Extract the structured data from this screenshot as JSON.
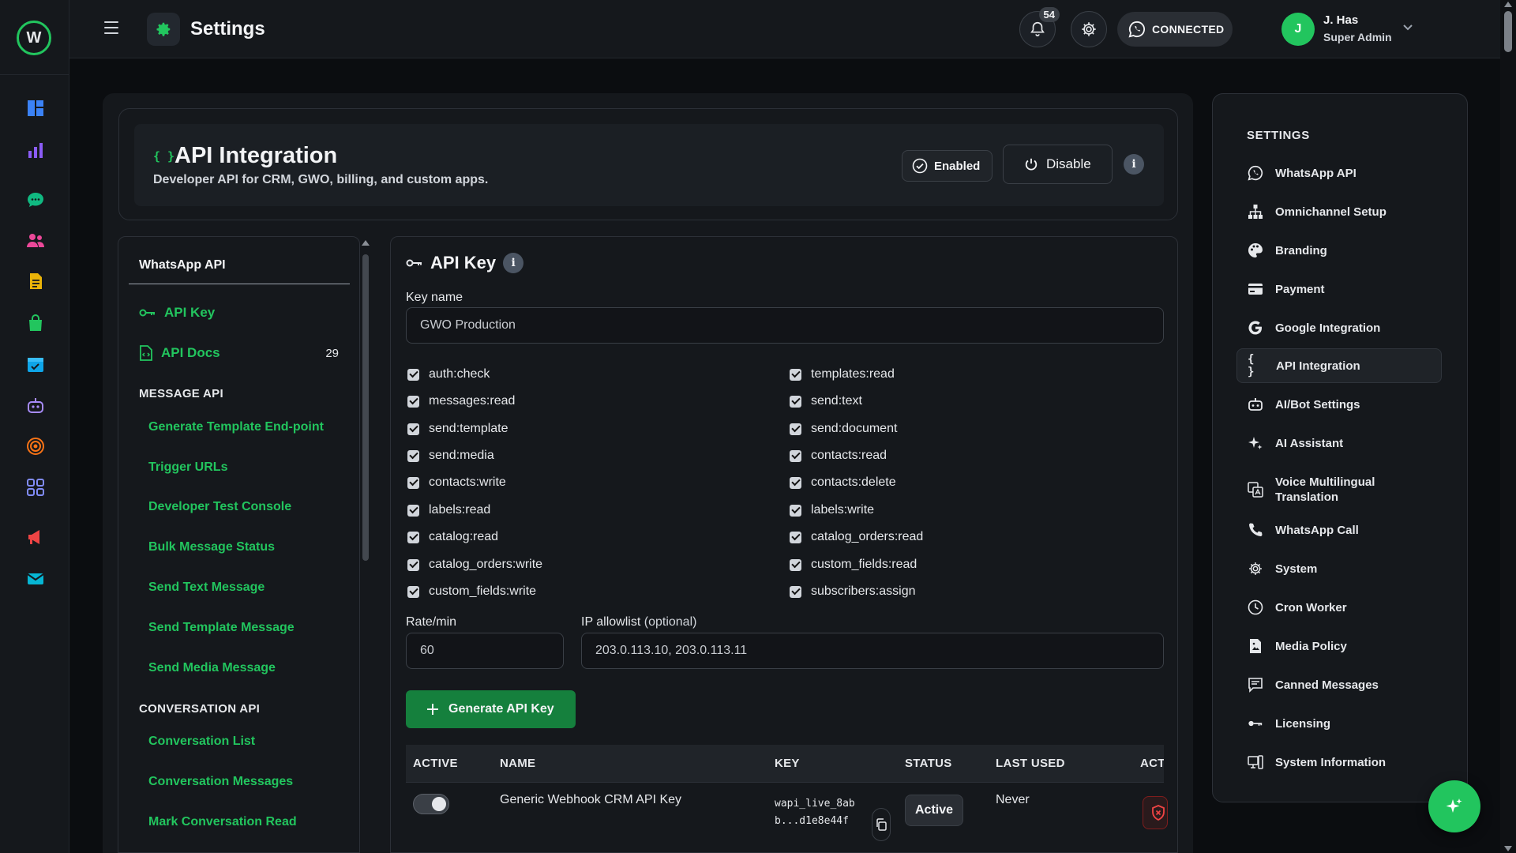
{
  "colors": {
    "accent": "#22c55e",
    "bg": "#0b0d10",
    "panel": "#15181c",
    "danger": "#ef4444"
  },
  "topbar": {
    "title": "Settings",
    "connection_status": "CONNECTED",
    "notifications_count": "54",
    "user": {
      "initial": "J",
      "name": "J. Has",
      "role": "Super Admin"
    }
  },
  "rail": {
    "icons": [
      "dashboard-icon",
      "analytics-icon",
      "chat-icon",
      "contacts-icon",
      "templates-icon",
      "shop-icon",
      "calendar-icon",
      "bot-icon",
      "target-icon",
      "apps-icon",
      "megaphone-icon",
      "email-icon"
    ]
  },
  "header": {
    "braces": "{ }",
    "title": "API Integration",
    "subtitle": "Developer API for CRM, GWO, billing, and custom apps.",
    "enabled_label": "Enabled",
    "disable_label": "Disable",
    "info": "i"
  },
  "left_nav": {
    "title": "WhatsApp API",
    "api_key_label": "API Key",
    "api_docs_label": "API Docs",
    "api_docs_count": "29",
    "message_api_heading": "MESSAGE API",
    "message_items": [
      "Generate Template End-point",
      "Trigger URLs",
      "Developer Test Console",
      "Bulk Message Status",
      "Send Text Message",
      "Send Template Message",
      "Send Media Message"
    ],
    "conversation_api_heading": "CONVERSATION API",
    "conversation_items": [
      "Conversation List",
      "Conversation Messages",
      "Mark Conversation Read"
    ]
  },
  "api_key": {
    "title": "API Key",
    "info": "i",
    "key_name_label": "Key name",
    "key_name_value": "GWO Production",
    "permissions_left": [
      "auth:check",
      "messages:read",
      "send:template",
      "send:media",
      "contacts:write",
      "labels:read",
      "catalog:read",
      "catalog_orders:write",
      "custom_fields:write"
    ],
    "permissions_right": [
      "templates:read",
      "send:text",
      "send:document",
      "contacts:read",
      "contacts:delete",
      "labels:write",
      "catalog_orders:read",
      "custom_fields:read",
      "subscribers:assign"
    ],
    "rate_label": "Rate/min",
    "rate_value": "60",
    "ip_label": "IP allowlist",
    "ip_optional": "(optional)",
    "ip_value": "203.0.113.10, 203.0.113.11",
    "generate_label": "Generate API Key",
    "table": {
      "headers": [
        "ACTIVE",
        "NAME",
        "KEY",
        "STATUS",
        "LAST USED",
        "ACT"
      ],
      "row": {
        "active": true,
        "name": "Generic Webhook CRM API Key",
        "key": "wapi_live_8abb...d1e8e44f",
        "status": "Active",
        "last_used": "Never"
      }
    }
  },
  "settings": {
    "heading": "SETTINGS",
    "items": [
      {
        "label": "WhatsApp API",
        "icon": "whatsapp-icon"
      },
      {
        "label": "Omnichannel Setup",
        "icon": "hierarchy-icon"
      },
      {
        "label": "Branding",
        "icon": "palette-icon"
      },
      {
        "label": "Payment",
        "icon": "payment-icon"
      },
      {
        "label": "Google Integration",
        "icon": "google-icon"
      },
      {
        "label": "API Integration",
        "icon": "braces-icon",
        "active": true
      },
      {
        "label": "AI/Bot Settings",
        "icon": "robot-icon"
      },
      {
        "label": "AI Assistant",
        "icon": "sparkle-icon"
      },
      {
        "label": "Voice Multilingual Translation",
        "icon": "translate-icon"
      },
      {
        "label": "WhatsApp Call",
        "icon": "phone-icon"
      },
      {
        "label": "System",
        "icon": "gear-icon"
      },
      {
        "label": "Cron Worker",
        "icon": "clock-icon"
      },
      {
        "label": "Media Policy",
        "icon": "media-icon"
      },
      {
        "label": "Canned Messages",
        "icon": "message-icon"
      },
      {
        "label": "Licensing",
        "icon": "key-icon"
      },
      {
        "label": "System Information",
        "icon": "monitor-icon"
      }
    ]
  }
}
